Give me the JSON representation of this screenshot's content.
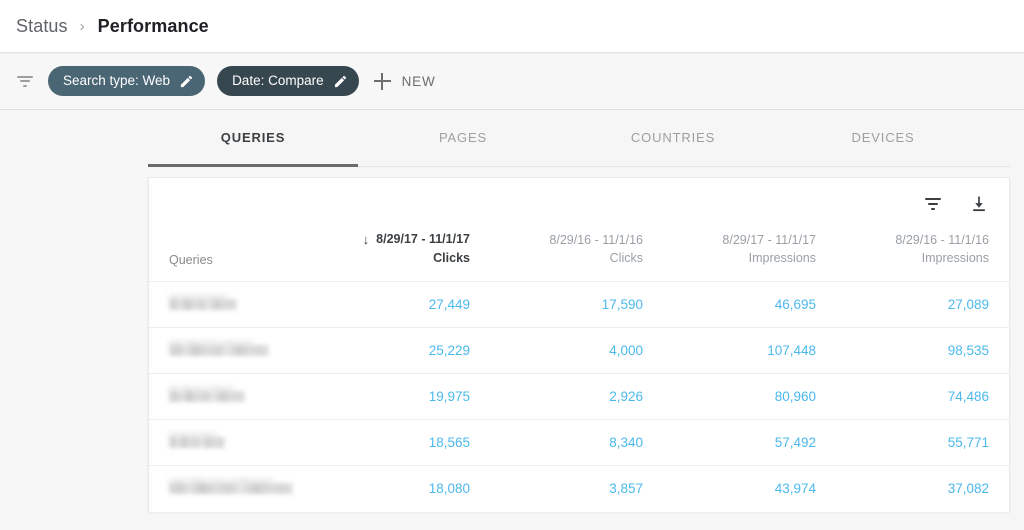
{
  "breadcrumb": {
    "parent": "Status",
    "separator": "›",
    "current": "Performance"
  },
  "toolbar": {
    "filter_icon": "filter-funnel-icon",
    "chips": [
      {
        "label": "Search type: Web",
        "color": "#4a6573",
        "edit_icon": "pencil-icon"
      },
      {
        "label": "Date: Compare",
        "color": "#37474f",
        "edit_icon": "pencil-icon"
      }
    ],
    "new_button": {
      "icon": "plus-icon",
      "label": "NEW"
    }
  },
  "tabs": [
    {
      "label": "QUERIES",
      "active": true
    },
    {
      "label": "PAGES",
      "active": false
    },
    {
      "label": "COUNTRIES",
      "active": false
    },
    {
      "label": "DEVICES",
      "active": false
    }
  ],
  "card": {
    "actions": [
      {
        "name": "filter-table-button",
        "icon": "filter-funnel-icon"
      },
      {
        "name": "download-button",
        "icon": "download-icon"
      }
    ],
    "columns": [
      {
        "key": "query",
        "date": "",
        "metric": "Queries",
        "sorted": false,
        "sort_arrow": ""
      },
      {
        "key": "clicks1",
        "date": "8/29/17 - 11/1/17",
        "metric": "Clicks",
        "sorted": true,
        "sort_arrow": "↓"
      },
      {
        "key": "clicks2",
        "date": "8/29/16 - 11/1/16",
        "metric": "Clicks",
        "sorted": false,
        "sort_arrow": ""
      },
      {
        "key": "impr1",
        "date": "8/29/17 - 11/1/17",
        "metric": "Impressions",
        "sorted": false,
        "sort_arrow": ""
      },
      {
        "key": "impr2",
        "date": "8/29/16 - 11/1/16",
        "metric": "Impressions",
        "sorted": false,
        "sort_arrow": ""
      }
    ],
    "rows": [
      {
        "query": "[redacted]",
        "query_blur_width": 68,
        "clicks1": "27,449",
        "clicks2": "17,590",
        "impr1": "46,695",
        "impr2": "27,089"
      },
      {
        "query": "[redacted]",
        "query_blur_width": 100,
        "clicks1": "25,229",
        "clicks2": "4,000",
        "impr1": "107,448",
        "impr2": "98,535"
      },
      {
        "query": "[redacted]",
        "query_blur_width": 76,
        "clicks1": "19,975",
        "clicks2": "2,926",
        "impr1": "80,960",
        "impr2": "74,486"
      },
      {
        "query": "[redacted]",
        "query_blur_width": 56,
        "clicks1": "18,565",
        "clicks2": "8,340",
        "impr1": "57,492",
        "impr2": "55,771"
      },
      {
        "query": "[redacted]",
        "query_blur_width": 124,
        "clicks1": "18,080",
        "clicks2": "3,857",
        "impr1": "43,974",
        "impr2": "37,082"
      }
    ]
  },
  "colors": {
    "metric_value": "#4cb9ed",
    "chip_light": "#4a6573",
    "chip_dark": "#37474f",
    "active_tab": "#3c4043",
    "page_background": "#f6f6f6"
  }
}
